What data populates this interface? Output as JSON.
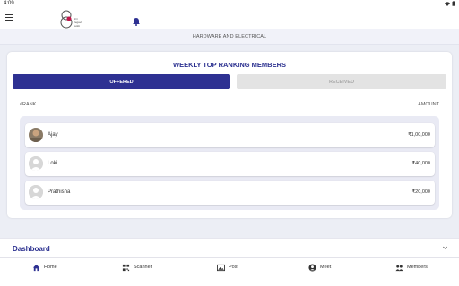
{
  "status_bar": {
    "time": "4:09"
  },
  "header": {
    "logo_text": "shri Vegavi buikti"
  },
  "subheader": {
    "title": "HARDWARE AND ELECTRICAL"
  },
  "ranking": {
    "title": "WEEKLY TOP RANKING MEMBERS",
    "tabs": {
      "offered": "OFFERED",
      "received": "RECEIVED"
    },
    "columns": {
      "rank": "#RANK",
      "amount": "AMOUNT"
    },
    "members": [
      {
        "name": "Ajay",
        "amount": "₹1,00,000",
        "avatar": "photo"
      },
      {
        "name": "Loki",
        "amount": "₹40,000",
        "avatar": "default-avatar-icon"
      },
      {
        "name": "Prathisha",
        "amount": "₹20,000",
        "avatar": "default-avatar-icon"
      }
    ]
  },
  "dashboard": {
    "label": "Dashboard"
  },
  "bottom_nav": {
    "items": [
      {
        "label": "Home",
        "icon": "home-icon"
      },
      {
        "label": "Scanner",
        "icon": "qr-icon"
      },
      {
        "label": "Post",
        "icon": "image-icon"
      },
      {
        "label": "Meet",
        "icon": "meet-icon"
      },
      {
        "label": "Members",
        "icon": "members-icon"
      }
    ]
  },
  "colors": {
    "primary": "#2e3192",
    "inactive_tab": "#e3e3e3",
    "background": "#eceef5"
  }
}
